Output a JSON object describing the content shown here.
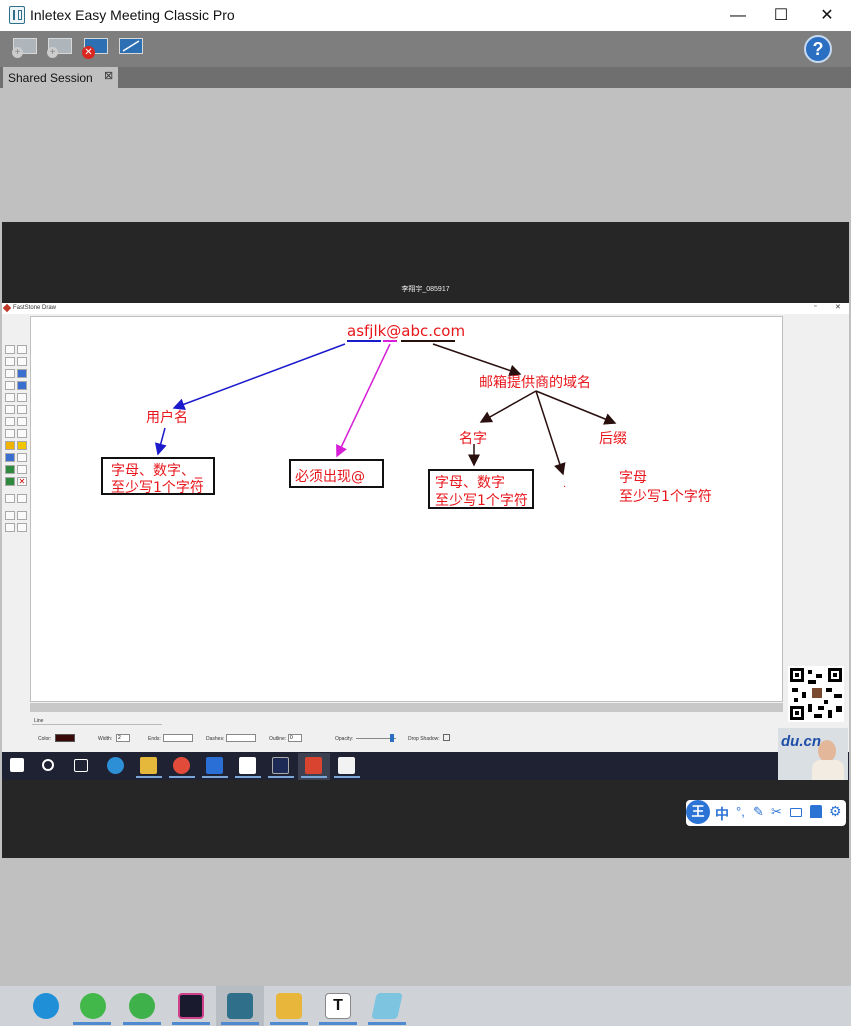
{
  "window": {
    "title": "Inletex Easy Meeting Classic Pro",
    "minimize_glyph": "—",
    "maximize_glyph": "☐",
    "close_glyph": "✕"
  },
  "toolbar": {
    "help_glyph": "?"
  },
  "tabs": [
    {
      "label": "Shared Session",
      "close_glyph": "⊠"
    }
  ],
  "session": {
    "presenter_name": "李翔宇_085917"
  },
  "draw_app": {
    "title": "FastStone Draw",
    "property_tab": "Line",
    "props": {
      "color_label": "Color:",
      "width_label": "Width:",
      "width_value": "2",
      "ends_label": "Ends:",
      "dashes_label": "Dashes:",
      "outline_label": "Outline:",
      "outline_value": "0",
      "opacity_label": "Opacity:",
      "drop_shadow_label": "Drop Shadow:"
    },
    "canvas_texts": {
      "email": "asfjlk@abc.com",
      "provider_domain": "邮箱提供商的域名",
      "username": "用户名",
      "username_rule_line1": "字母、数字、_",
      "username_rule_line2": "至少写1个字符",
      "must_have_at": "必须出现@",
      "name": "名字",
      "name_rule_line1": "字母、数字",
      "name_rule_line2": "至少写1个字符",
      "dot": ".",
      "suffix": "后缀",
      "suffix_rule_line1": "字母",
      "suffix_rule_line2": "至少写1个字符"
    }
  },
  "overlay": {
    "webcam_watermark": "du.cn",
    "ime_icon": "王",
    "ime_mode": "中"
  },
  "colors": {
    "titlebar": "#ffffff",
    "toolbar": "#7e7e7e",
    "session_bg": "#c0c0c0",
    "annotation_red": "#e8161b",
    "arrow_blue": "#1b1bcc",
    "arrow_magenta": "#d61fd6",
    "arrow_dark": "#2a0f0f"
  }
}
